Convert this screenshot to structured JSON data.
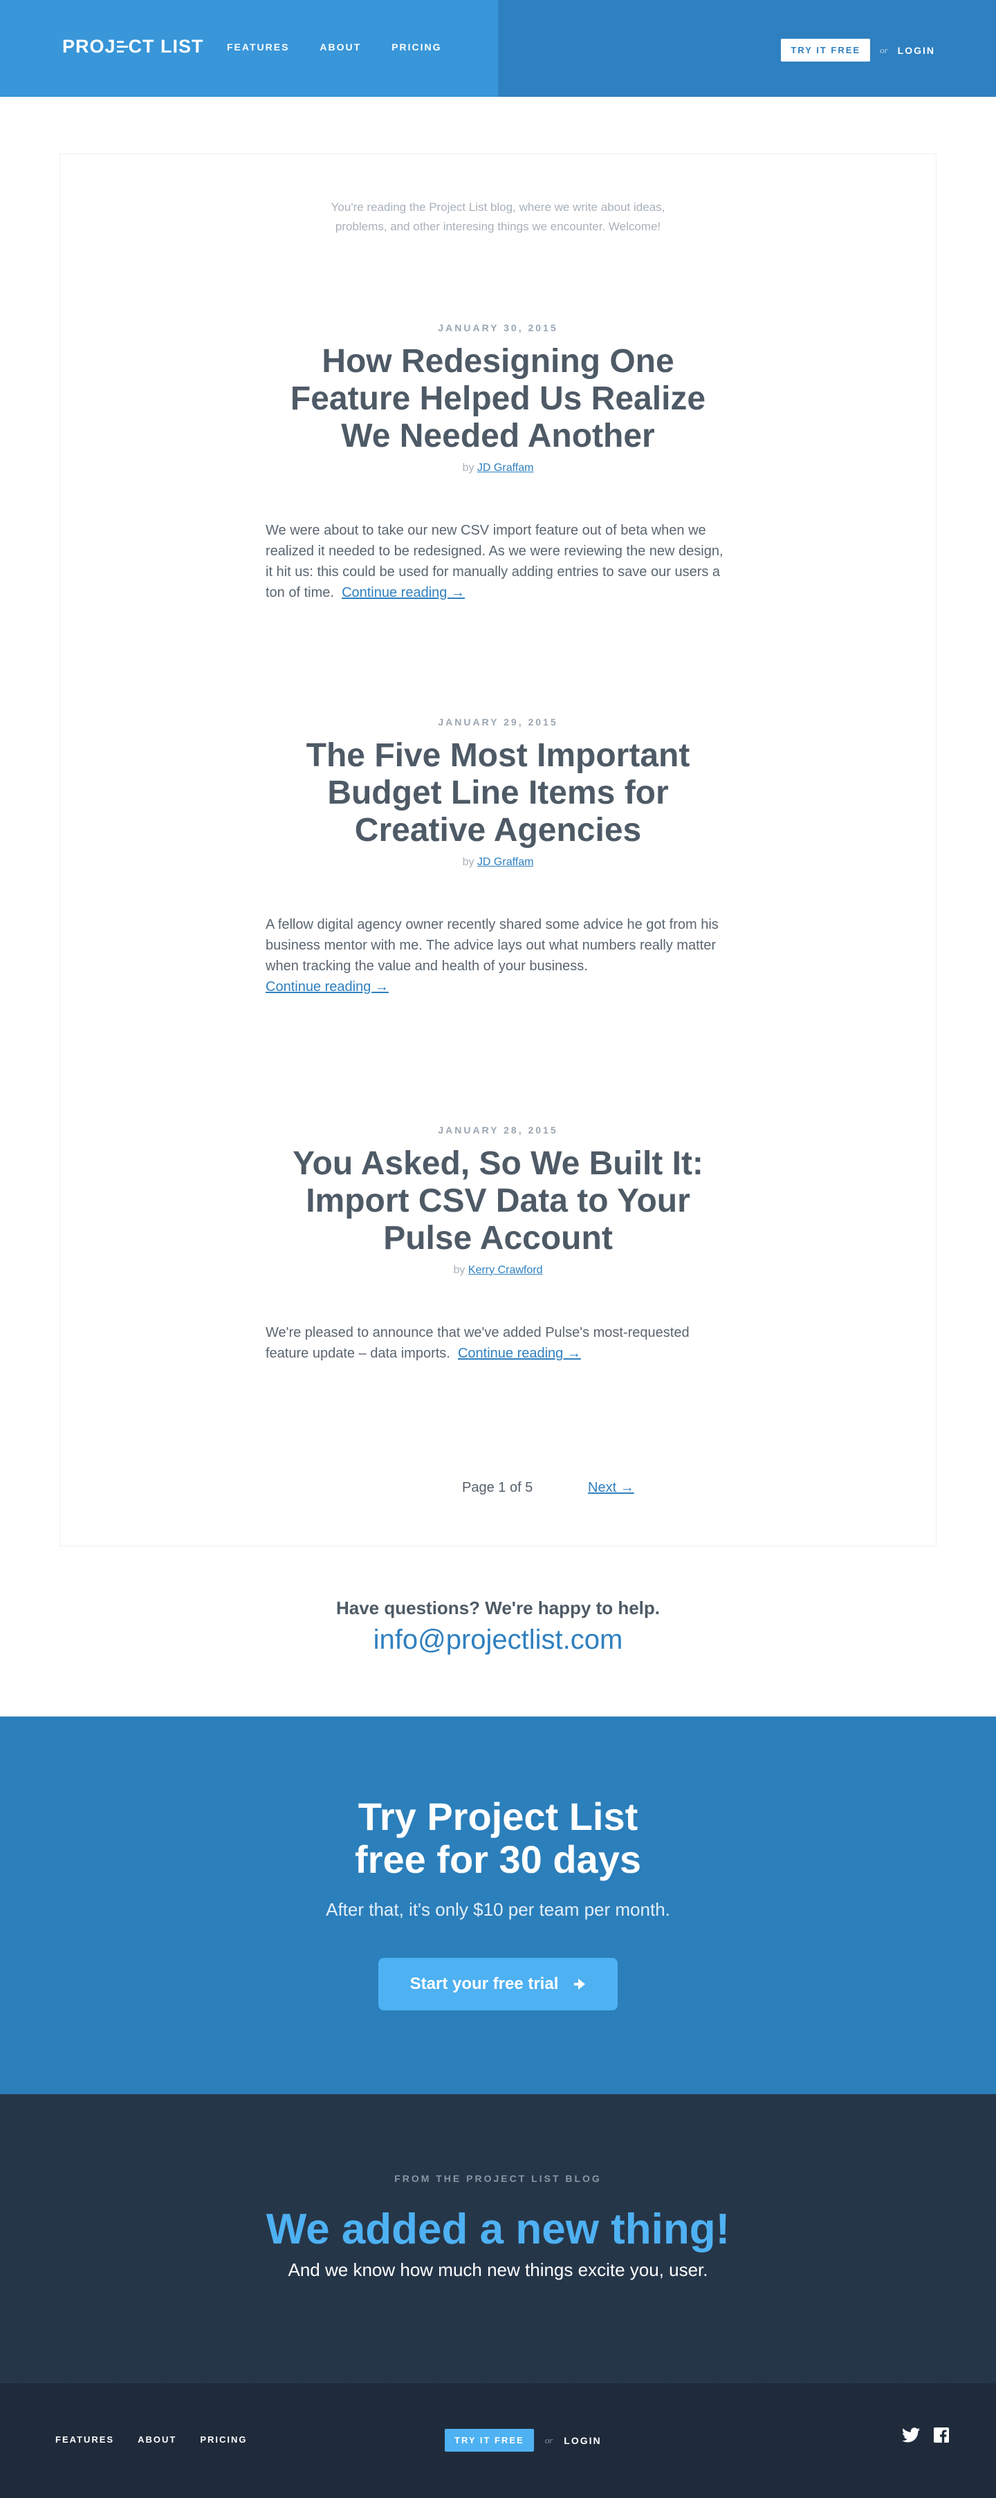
{
  "header": {
    "logo_text_left": "PROJ",
    "logo_text_right": "CT LIST",
    "nav": [
      {
        "label": "FEATURES"
      },
      {
        "label": "ABOUT"
      },
      {
        "label": "PRICING"
      }
    ],
    "try_label": "TRY IT FREE",
    "or_label": "or",
    "login_label": "LOGIN"
  },
  "blog": {
    "intro_line1": "You're reading the Project List blog, where we write about ideas,",
    "intro_line2": "problems, and other interesing things we encounter. Welcome!",
    "posts": [
      {
        "date": "JANUARY 30, 2015",
        "title": "How Redesigning One Feature Helped Us Realize We Needed Another",
        "by": "by",
        "author": "JD Graffam",
        "excerpt": "We were about to take our new CSV import feature out of beta when we realized it needed to be redesigned. As we were reviewing the new design, it hit us: this could be used for manually adding entries to save our users a ton of time.",
        "continue": "Continue reading →"
      },
      {
        "date": "JANUARY 29, 2015",
        "title": "The Five Most Important Budget Line Items for Creative Agencies",
        "by": "by",
        "author": "JD Graffam",
        "excerpt": "A fellow digital agency owner recently shared some advice he got from his business mentor with me. The advice lays out what numbers really matter when tracking the value and health of your business.",
        "continue": "Continue reading →"
      },
      {
        "date": "JANUARY 28, 2015",
        "title": "You Asked, So We Built It: Import CSV Data to Your Pulse Account",
        "by": "by",
        "author": "Kerry Crawford",
        "excerpt": "We're pleased to announce that we've added Pulse's most-requested feature update – data imports.",
        "continue": "Continue reading →"
      }
    ],
    "pager": {
      "page_label": "Page 1 of 5",
      "next_label": "Next →"
    }
  },
  "help": {
    "question": "Have questions? We're happy to help.",
    "email": "info@projectlist.com"
  },
  "cta": {
    "title_line1": "Try Project List",
    "title_line2": "free for 30 days",
    "subtitle": "After that, it's only $10 per team per month.",
    "button_label": "Start your free trial"
  },
  "from_blog": {
    "eyebrow": "FROM THE PROJECT LIST BLOG",
    "title": "We added a new thing!",
    "subtitle": "And we know how much new things excite you, user."
  },
  "footer": {
    "nav": [
      {
        "label": "FEATURES"
      },
      {
        "label": "ABOUT"
      },
      {
        "label": "PRICING"
      }
    ],
    "try_label": "TRY IT FREE",
    "or_label": "or",
    "login_label": "LOGIN",
    "social": [
      "twitter-icon",
      "facebook-icon"
    ]
  },
  "colors": {
    "header_left": "#3896d9",
    "header_right": "#2f80c0",
    "link": "#2f80c0",
    "cta_bg": "#2b7fbb",
    "cta_button": "#4eb1f2",
    "dark_bg": "#263649",
    "footer_bg": "#1f2b3b"
  }
}
